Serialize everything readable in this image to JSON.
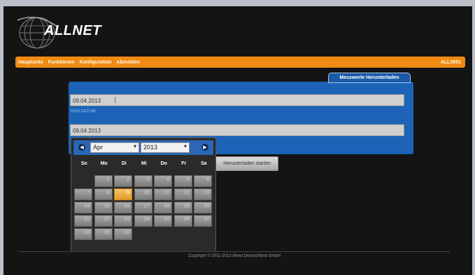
{
  "brand": {
    "logo_text": "ALLNET"
  },
  "nav": {
    "items": [
      "Hauptseite",
      "Funktionen",
      "Konfiguration",
      "Abmelden"
    ],
    "device_id": "ALL3691"
  },
  "panel": {
    "tab_label": "Messwerte Herunterladen",
    "from_date_value": "09.04.2013",
    "from_date_label": "VON DATUM",
    "to_date_value": "09.04.2013",
    "start_button_label": "Herunterladen starten"
  },
  "datepicker": {
    "prev_icon": "◀",
    "next_icon": "▶",
    "month": "Apr",
    "year": "2013",
    "weekdays": [
      "So",
      "Mo",
      "Di",
      "Mi",
      "Do",
      "Fr",
      "Sa"
    ],
    "leading_blanks": 1,
    "days": [
      1,
      2,
      3,
      4,
      5,
      6,
      7,
      8,
      9,
      10,
      11,
      12,
      13,
      14,
      15,
      16,
      17,
      18,
      19,
      20,
      21,
      22,
      23,
      24,
      25,
      26,
      27,
      28,
      29,
      30
    ],
    "selected_day": 9
  },
  "footer": {
    "copyright": "Copyright © 2011-2013 Allnet Deutschland GmbH"
  },
  "colors": {
    "accent": "#f08a12",
    "panel_blue": "#1c63b8",
    "selected": "#e49a2a"
  }
}
